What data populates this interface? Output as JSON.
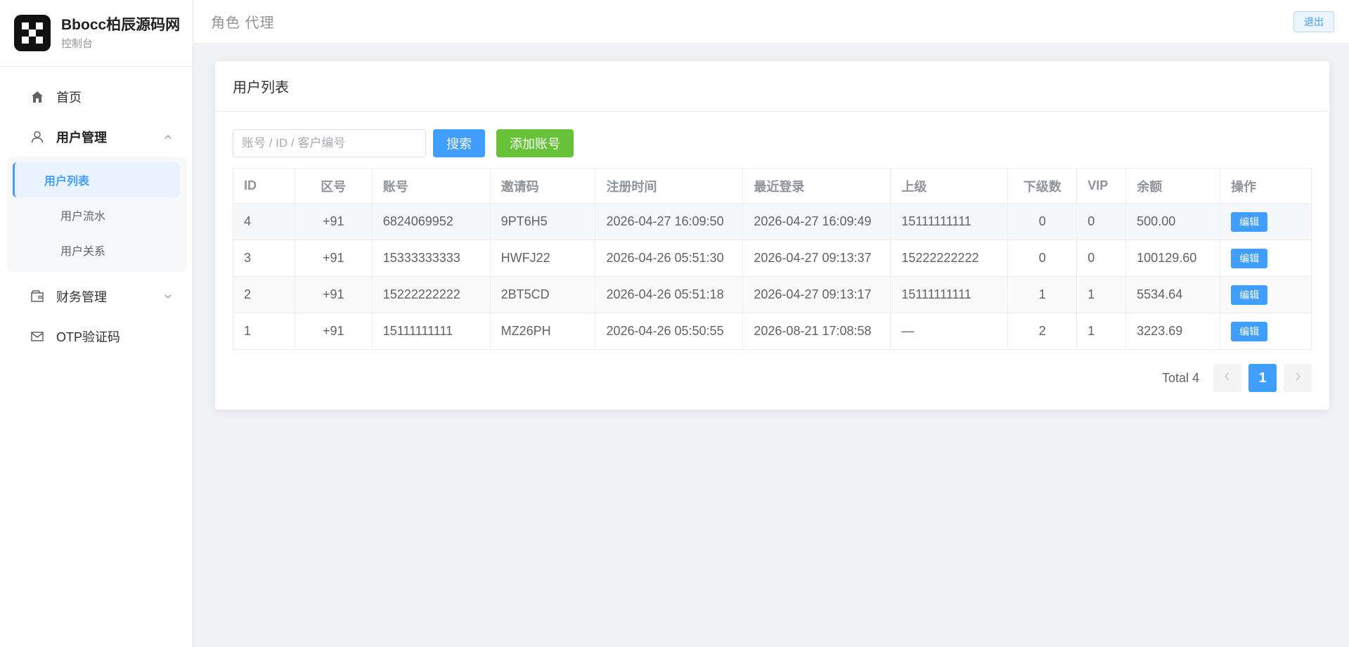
{
  "brand": {
    "title": "Bbocc柏辰源码网",
    "subtitle": "控制台"
  },
  "sidebar": {
    "items": [
      {
        "label": "首页",
        "icon": "home-icon"
      },
      {
        "label": "用户管理",
        "icon": "user-icon"
      },
      {
        "label": "财务管理",
        "icon": "wallet-icon"
      },
      {
        "label": "OTP验证码",
        "icon": "mail-icon"
      }
    ],
    "user_submenu": [
      {
        "label": "用户列表"
      },
      {
        "label": "用户流水"
      },
      {
        "label": "用户关系"
      }
    ]
  },
  "topbar": {
    "title": "角色 代理",
    "logout_label": "退出"
  },
  "card": {
    "title": "用户列表"
  },
  "toolbar": {
    "search_placeholder": "账号 / ID / 客户编号",
    "search_label": "搜索",
    "add_label": "添加账号"
  },
  "table": {
    "headers": [
      "ID",
      "区号",
      "账号",
      "邀请码",
      "注册时间",
      "最近登录",
      "上级",
      "下级数",
      "VIP",
      "余额",
      "操作"
    ],
    "edit_label": "编辑",
    "rows": [
      {
        "id": "4",
        "area": "+91",
        "account": "6824069952",
        "invite": "9PT6H5",
        "registered": "2026-04-27 16:09:50",
        "last_login": "2026-04-27 16:09:49",
        "parent": "15111111111",
        "children": "0",
        "vip": "0",
        "balance": "500.00"
      },
      {
        "id": "3",
        "area": "+91",
        "account": "15333333333",
        "invite": "HWFJ22",
        "registered": "2026-04-26 05:51:30",
        "last_login": "2026-04-27 09:13:37",
        "parent": "15222222222",
        "children": "0",
        "vip": "0",
        "balance": "100129.60"
      },
      {
        "id": "2",
        "area": "+91",
        "account": "15222222222",
        "invite": "2BT5CD",
        "registered": "2026-04-26 05:51:18",
        "last_login": "2026-04-27 09:13:17",
        "parent": "15111111111",
        "children": "1",
        "vip": "1",
        "balance": "5534.64"
      },
      {
        "id": "1",
        "area": "+91",
        "account": "15111111111",
        "invite": "MZ26PH",
        "registered": "2026-04-26 05:50:55",
        "last_login": "2026-08-21 17:08:58",
        "parent": "—",
        "children": "2",
        "vip": "1",
        "balance": "3223.69"
      }
    ]
  },
  "pagination": {
    "total_label": "Total 4",
    "current_page": "1",
    "prev_icon": "chevron-left-icon",
    "next_icon": "chevron-right-icon"
  },
  "colors": {
    "primary": "#409eff",
    "success": "#67c23a"
  }
}
